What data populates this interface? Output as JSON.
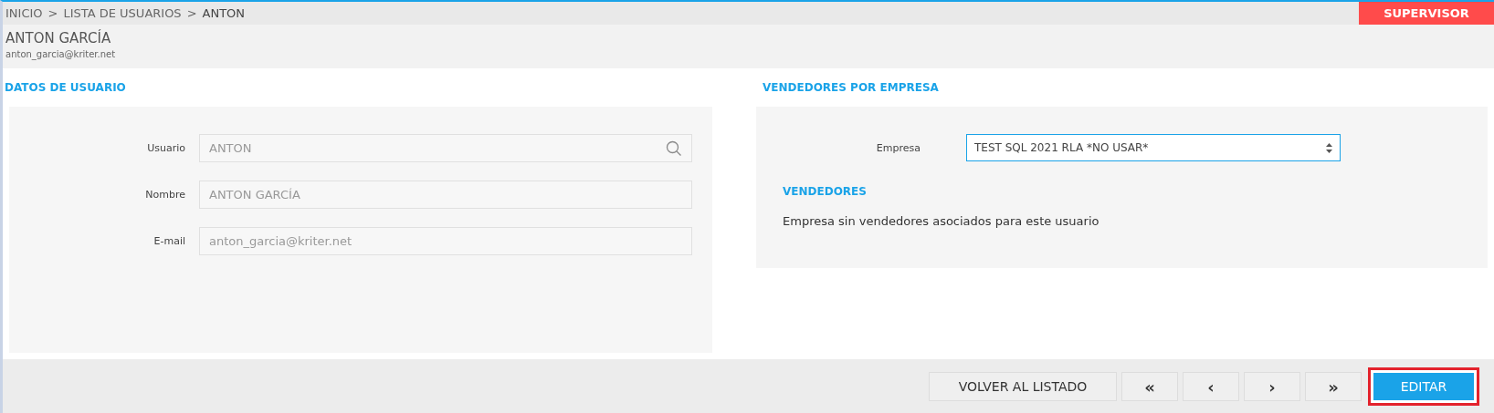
{
  "breadcrumb": [
    "INICIO",
    "LISTA DE USUARIOS",
    "ANTON"
  ],
  "breadcrumb_separator": ">",
  "role_badge": "SUPERVISOR",
  "header": {
    "name": "ANTON GARCÍA",
    "email": "anton_garcia@kriter.net"
  },
  "user_data": {
    "title": "DATOS DE USUARIO",
    "fields": [
      {
        "label": "Usuario",
        "value": "ANTON",
        "kind": "search"
      },
      {
        "label": "Nombre",
        "value": "ANTON GARCÍA",
        "kind": "text"
      },
      {
        "label": "E-mail",
        "value": "anton_garcia@kriter.net",
        "kind": "text"
      }
    ]
  },
  "sellers": {
    "title": "VENDEDORES POR EMPRESA",
    "company_label": "Empresa",
    "company_value": "TEST SQL 2021 RLA *NO USAR*",
    "subtitle": "VENDEDORES",
    "empty_message": "Empresa sin vendedores asociados para este usuario"
  },
  "footer": {
    "buttons": [
      {
        "label": "VOLVER AL LISTADO",
        "kind": "text",
        "highlighted": false
      },
      {
        "label": "«",
        "kind": "nav",
        "highlighted": false
      },
      {
        "label": "‹",
        "kind": "nav",
        "highlighted": false
      },
      {
        "label": "›",
        "kind": "nav",
        "highlighted": false
      },
      {
        "label": "»",
        "kind": "nav",
        "highlighted": false
      },
      {
        "label": "EDITAR",
        "kind": "primary",
        "highlighted": true
      }
    ]
  }
}
